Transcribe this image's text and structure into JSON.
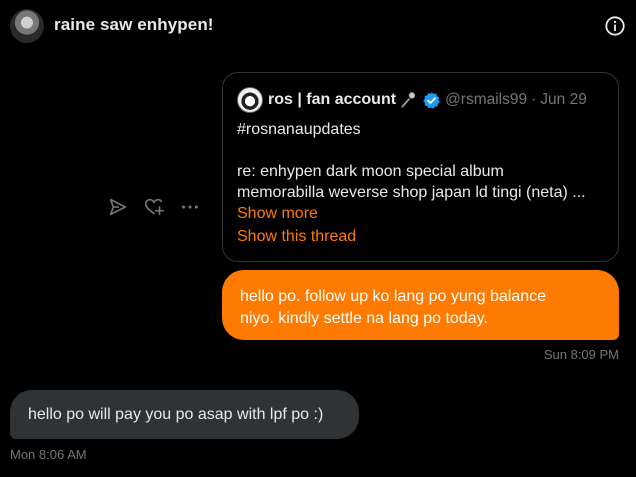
{
  "header": {
    "title": "raine saw enhypen!",
    "info_icon": "info-circle-icon"
  },
  "quoted_tweet": {
    "display_name": "ros | fan account",
    "name_emoji_icon": "microphone-icon",
    "verified_icon": "verified-badge-icon",
    "handle": "@rsmails99",
    "separator": "·",
    "date": "Jun 29",
    "lines": [
      "#rosnanaupdates",
      "",
      "re: enhypen dark moon special album",
      "memorabilla weverse shop japan ld tingi (neta) ..."
    ],
    "show_more": "Show more",
    "show_thread": "Show this thread"
  },
  "actions": {
    "icons": [
      "send-icon",
      "react-add-icon",
      "more-options-icon"
    ]
  },
  "messages": {
    "sent": {
      "lines": [
        "hello po. follow up ko lang po yung balance",
        "niyo. kindly settle na lang po today."
      ],
      "timestamp": "Sun 8:09 PM"
    },
    "received": {
      "text": "hello po will pay you po asap with lpf po :)",
      "timestamp": "Mon 8:06 AM"
    }
  },
  "colors": {
    "background": "#000000",
    "accent": "#ff7a00",
    "received_bubble": "#2f3336",
    "muted_text": "#71767b",
    "verified_blue": "#1d9bf0"
  }
}
